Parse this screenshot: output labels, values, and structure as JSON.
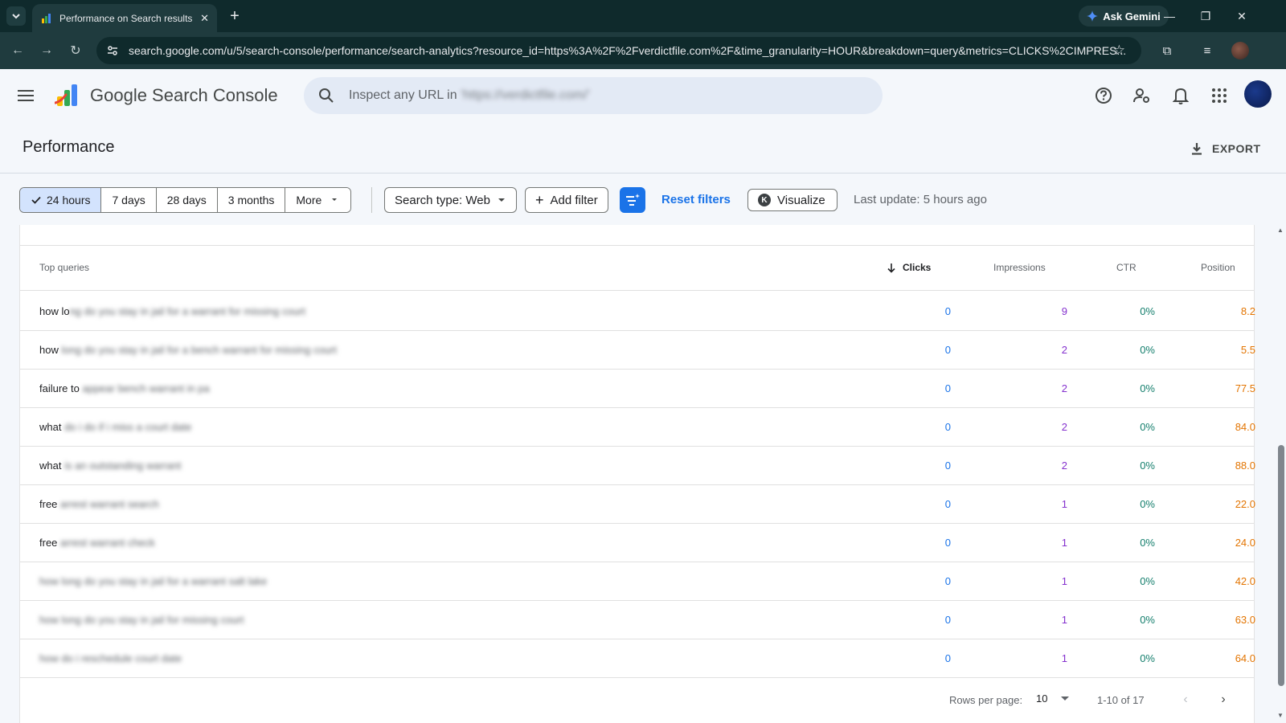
{
  "browser": {
    "tab_title": "Performance on Search results",
    "ask_gemini": "Ask Gemini",
    "url": "search.google.com/u/5/search-console/performance/search-analytics?resource_id=https%3A%2F%2Fverdictfile.com%2F&time_granularity=HOUR&breakdown=query&metrics=CLICKS%2CIMPRES..."
  },
  "header": {
    "app_title": "Google Search Console",
    "search_placeholder_prefix": "Inspect any URL in",
    "search_placeholder_domain": "'https://verdictfile.com/'"
  },
  "page": {
    "title": "Performance",
    "export_label": "EXPORT"
  },
  "filters": {
    "date_ranges": [
      "24 hours",
      "7 days",
      "28 days",
      "3 months",
      "More"
    ],
    "search_type": "Search type: Web",
    "add_filter": "Add filter",
    "reset_filters": "Reset filters",
    "visualize": "Visualize",
    "visualize_badge": "K",
    "last_update": "Last update: 5 hours ago"
  },
  "table": {
    "headers": {
      "query": "Top queries",
      "clicks": "Clicks",
      "impressions": "Impressions",
      "ctr": "CTR",
      "position": "Position"
    },
    "rows": [
      {
        "q_visible": "how lo",
        "q_blurred": "ng do you stay in jail for a warrant for missing court",
        "clicks": "0",
        "impressions": "9",
        "ctr": "0%",
        "position": "8.2"
      },
      {
        "q_visible": "how ",
        "q_blurred": "long do you stay in jail for a bench warrant for missing court",
        "clicks": "0",
        "impressions": "2",
        "ctr": "0%",
        "position": "5.5"
      },
      {
        "q_visible": "failure to ",
        "q_blurred": "appear bench warrant in pa",
        "clicks": "0",
        "impressions": "2",
        "ctr": "0%",
        "position": "77.5"
      },
      {
        "q_visible": "what ",
        "q_blurred": "do i do if i miss a court date",
        "clicks": "0",
        "impressions": "2",
        "ctr": "0%",
        "position": "84.0"
      },
      {
        "q_visible": "what ",
        "q_blurred": "is an outstanding warrant",
        "clicks": "0",
        "impressions": "2",
        "ctr": "0%",
        "position": "88.0"
      },
      {
        "q_visible": "free ",
        "q_blurred": "arrest warrant search",
        "clicks": "0",
        "impressions": "1",
        "ctr": "0%",
        "position": "22.0"
      },
      {
        "q_visible": "free ",
        "q_blurred": "arrest warrant check",
        "clicks": "0",
        "impressions": "1",
        "ctr": "0%",
        "position": "24.0"
      },
      {
        "q_visible": "",
        "q_blurred": "how long do you stay in jail for a warrant salt lake",
        "clicks": "0",
        "impressions": "1",
        "ctr": "0%",
        "position": "42.0"
      },
      {
        "q_visible": "",
        "q_blurred": "how long do you stay in jail for missing court",
        "clicks": "0",
        "impressions": "1",
        "ctr": "0%",
        "position": "63.0"
      },
      {
        "q_visible": "",
        "q_blurred": "how do i reschedule court date",
        "clicks": "0",
        "impressions": "1",
        "ctr": "0%",
        "position": "64.0"
      }
    ]
  },
  "pagination": {
    "rows_per_page_label": "Rows per page:",
    "rows_per_page_value": "10",
    "range": "1-10 of 17"
  },
  "colors": {
    "accent": "#1a73e8",
    "clicks": "#1a73e8",
    "impressions": "#8430ce",
    "ctr": "#137e6c",
    "position": "#e37400"
  }
}
